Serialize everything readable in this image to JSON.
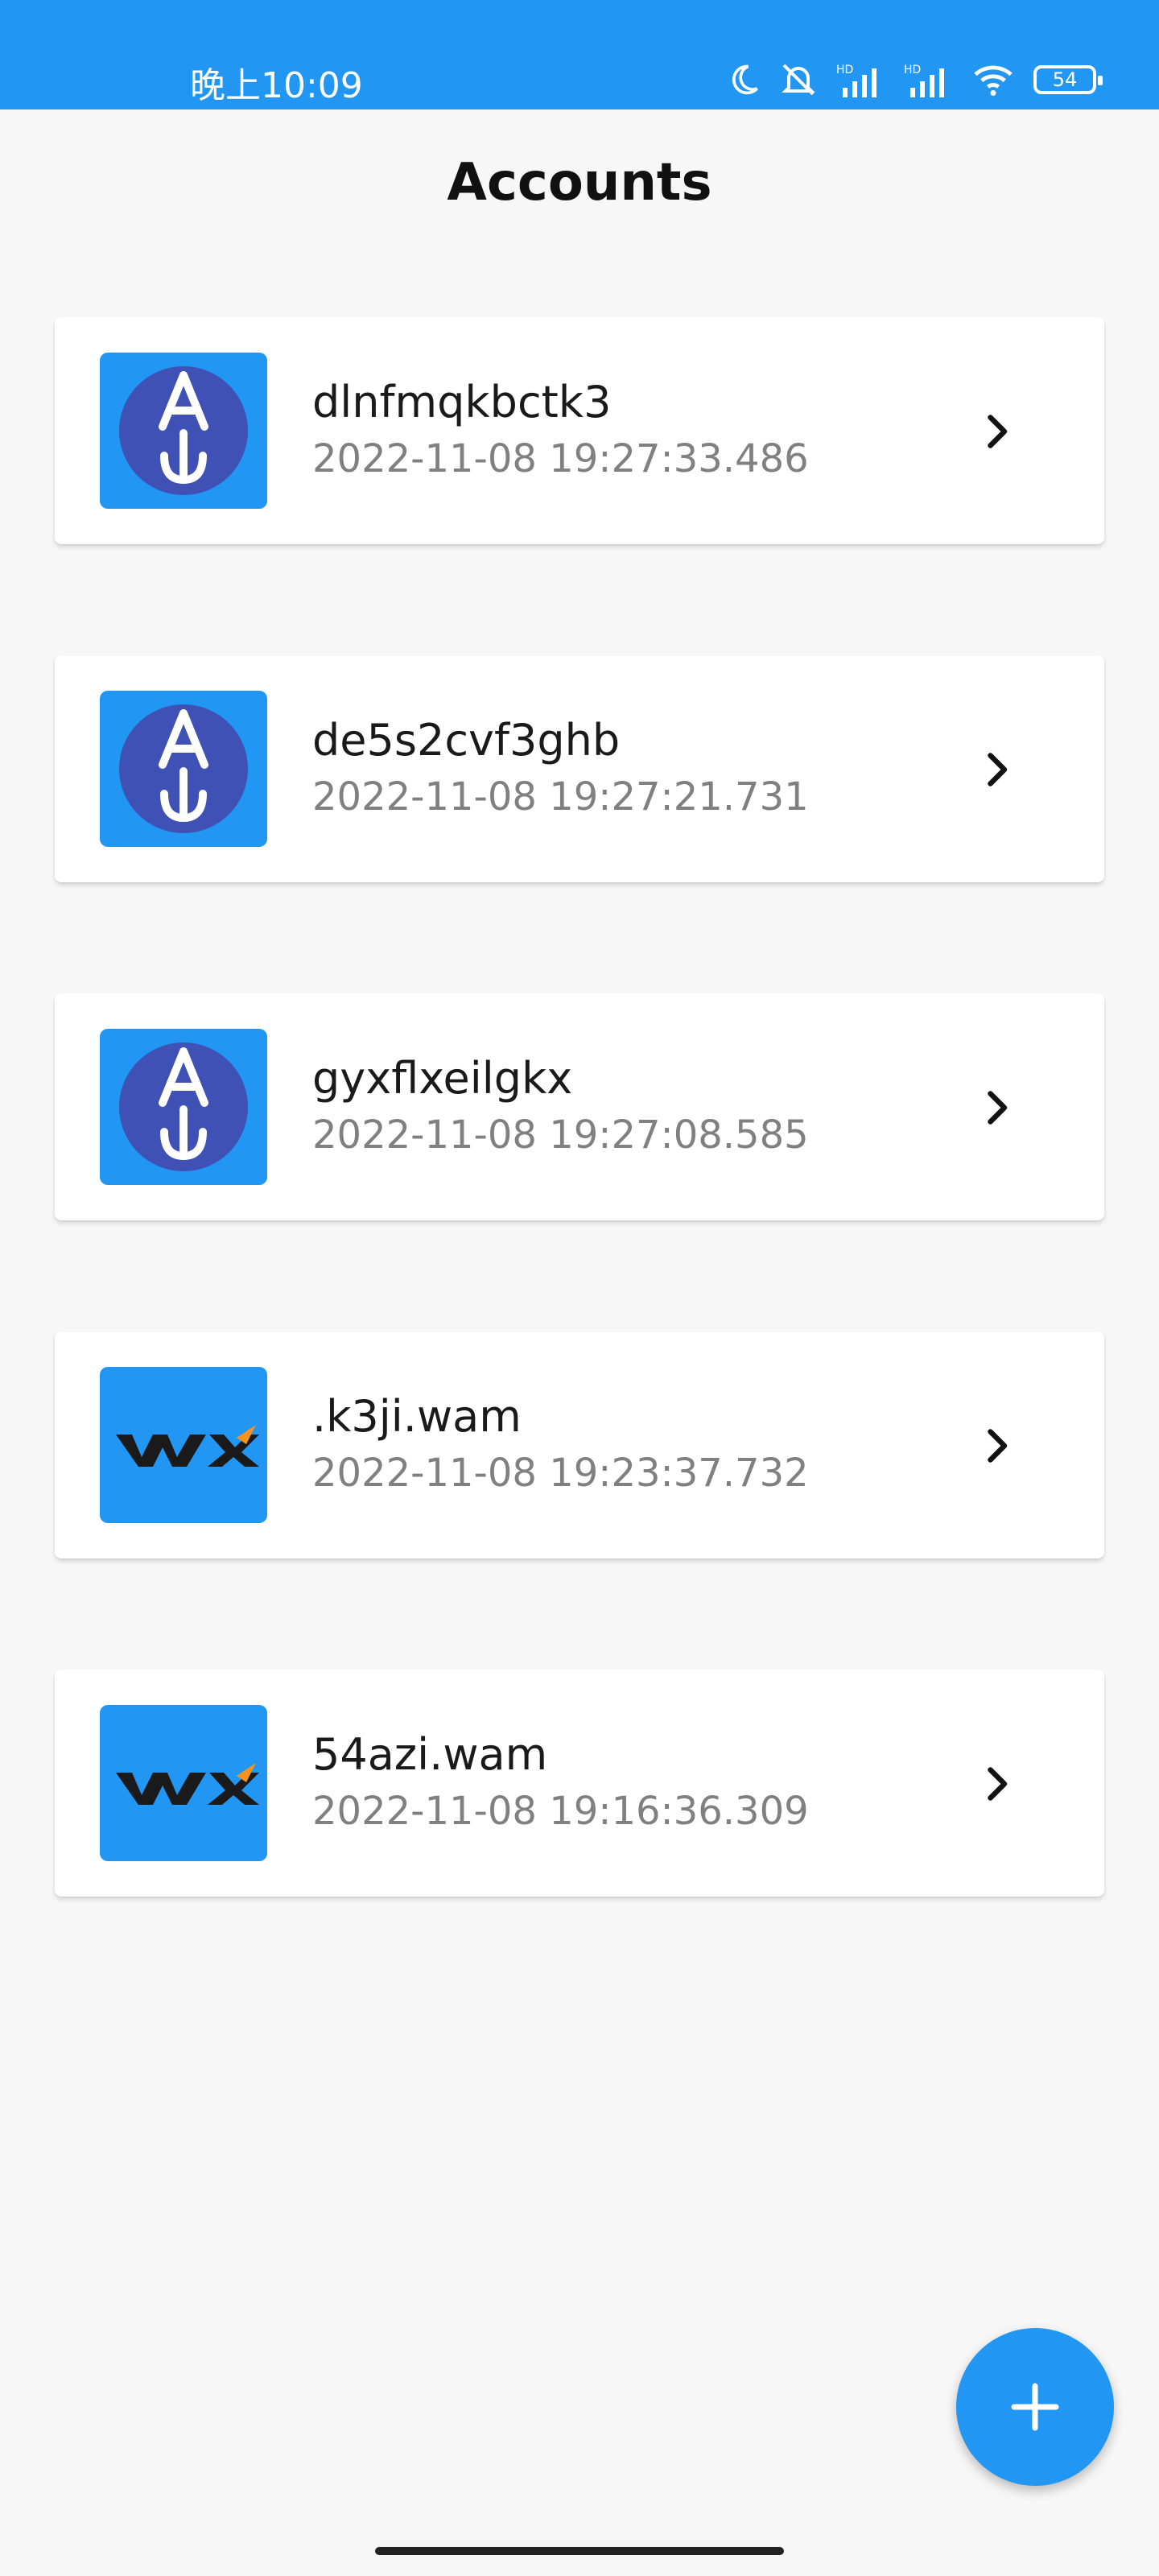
{
  "status_bar": {
    "time": "晚上10:09",
    "battery": "54",
    "icons": [
      "moon-icon",
      "muted-bell-icon",
      "hd-signal-icon",
      "hd-signal-icon",
      "wifi-icon",
      "battery-icon"
    ]
  },
  "header": {
    "title": "Accounts"
  },
  "accounts": [
    {
      "name": "dlnfmqkbctk3",
      "date": "2022-11-08 19:27:33.486",
      "logo": "anchor-logo"
    },
    {
      "name": "de5s2cvf3ghb",
      "date": "2022-11-08 19:27:21.731",
      "logo": "anchor-logo"
    },
    {
      "name": "gyxflxeilgkx",
      "date": "2022-11-08 19:27:08.585",
      "logo": "anchor-logo"
    },
    {
      "name": ".k3ji.wam",
      "date": "2022-11-08 19:23:37.732",
      "logo": "wax-logo"
    },
    {
      "name": "54azi.wam",
      "date": "2022-11-08 19:16:36.309",
      "logo": "wax-logo"
    }
  ],
  "fab": {
    "icon": "plus-icon"
  },
  "colors": {
    "primary": "#2196f3",
    "anchor_circle": "#3f51b5",
    "wax_orange": "#f7931a"
  }
}
